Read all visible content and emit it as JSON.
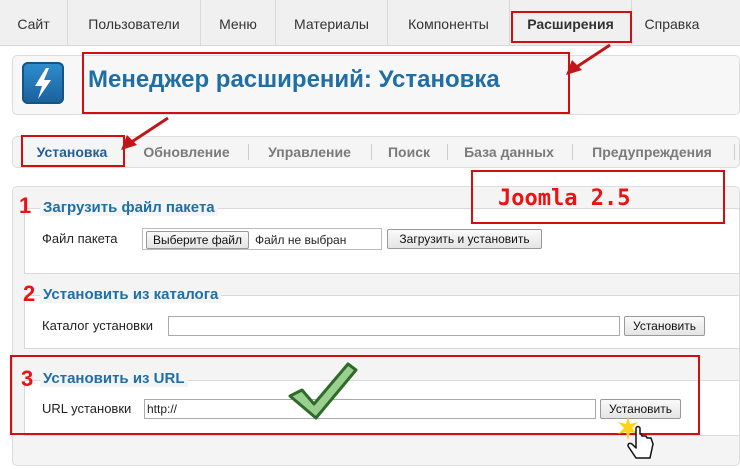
{
  "menu": {
    "items": [
      {
        "label": "Сайт"
      },
      {
        "label": "Пользователи"
      },
      {
        "label": "Меню"
      },
      {
        "label": "Материалы"
      },
      {
        "label": "Компоненты"
      },
      {
        "label": "Расширения"
      },
      {
        "label": "Справка"
      }
    ]
  },
  "header": {
    "title": "Менеджер расширений: Установка",
    "icon": "lightning-bolt-icon"
  },
  "tabs": [
    {
      "label": "Установка"
    },
    {
      "label": "Обновление"
    },
    {
      "label": "Управление"
    },
    {
      "label": "Поиск"
    },
    {
      "label": "База данных"
    },
    {
      "label": "Предупреждения"
    }
  ],
  "annotation": {
    "version": "Joomla 2.5",
    "n1": "1",
    "n2": "2",
    "n3": "3"
  },
  "upload": {
    "legend": "Загрузить файл пакета",
    "field_label": "Файл пакета",
    "choose_button": "Выберите файл",
    "no_file": "Файл не выбран",
    "submit": "Загрузить и установить"
  },
  "folder": {
    "legend": "Установить из каталога",
    "field_label": "Каталог установки",
    "value": "",
    "submit": "Установить"
  },
  "url": {
    "legend": "Установить из URL",
    "field_label": "URL установки",
    "value": "http://",
    "submit": "Установить"
  }
}
